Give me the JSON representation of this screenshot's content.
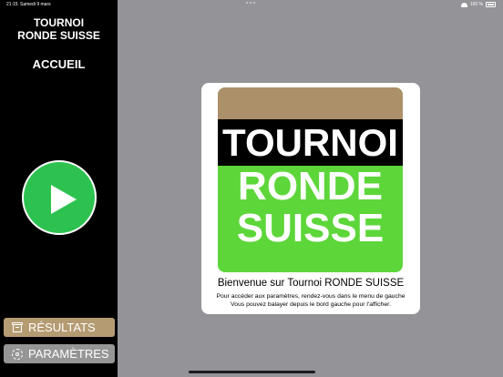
{
  "status_bar": {
    "time": "21:15",
    "date": "Samedi 9 mars",
    "battery_text": "100 %"
  },
  "sidebar": {
    "app_title_line1": "TOURNOI",
    "app_title_line2": "RONDE SUISSE",
    "home_label": "ACCUEIL",
    "results_label": "RÉSULTATS",
    "settings_label": "PARAMÈTRES"
  },
  "welcome": {
    "logo_line1": "TOURNOI",
    "logo_line2": "RONDE",
    "logo_line3": "SUISSE",
    "title": "Bienvenue sur Tournoi RONDE SUISSE",
    "line1": "Pour accéder aux paramètres, rendez-vous dans le menu de gauche",
    "line2": "Vous pouvez balayer depuis le bord gauche pour l'afficher."
  },
  "colors": {
    "sidebar_bg": "#000000",
    "content_bg": "#939398",
    "play_green": "#2dc250",
    "results_tan": "#b59b72",
    "settings_gray": "#959595",
    "logo_tan": "#ab9069",
    "logo_green": "#5dd63a"
  },
  "icons": {
    "play": "play-icon",
    "results": "archive-icon",
    "settings": "gear-icon",
    "wifi": "wifi-icon",
    "battery": "battery-icon"
  }
}
